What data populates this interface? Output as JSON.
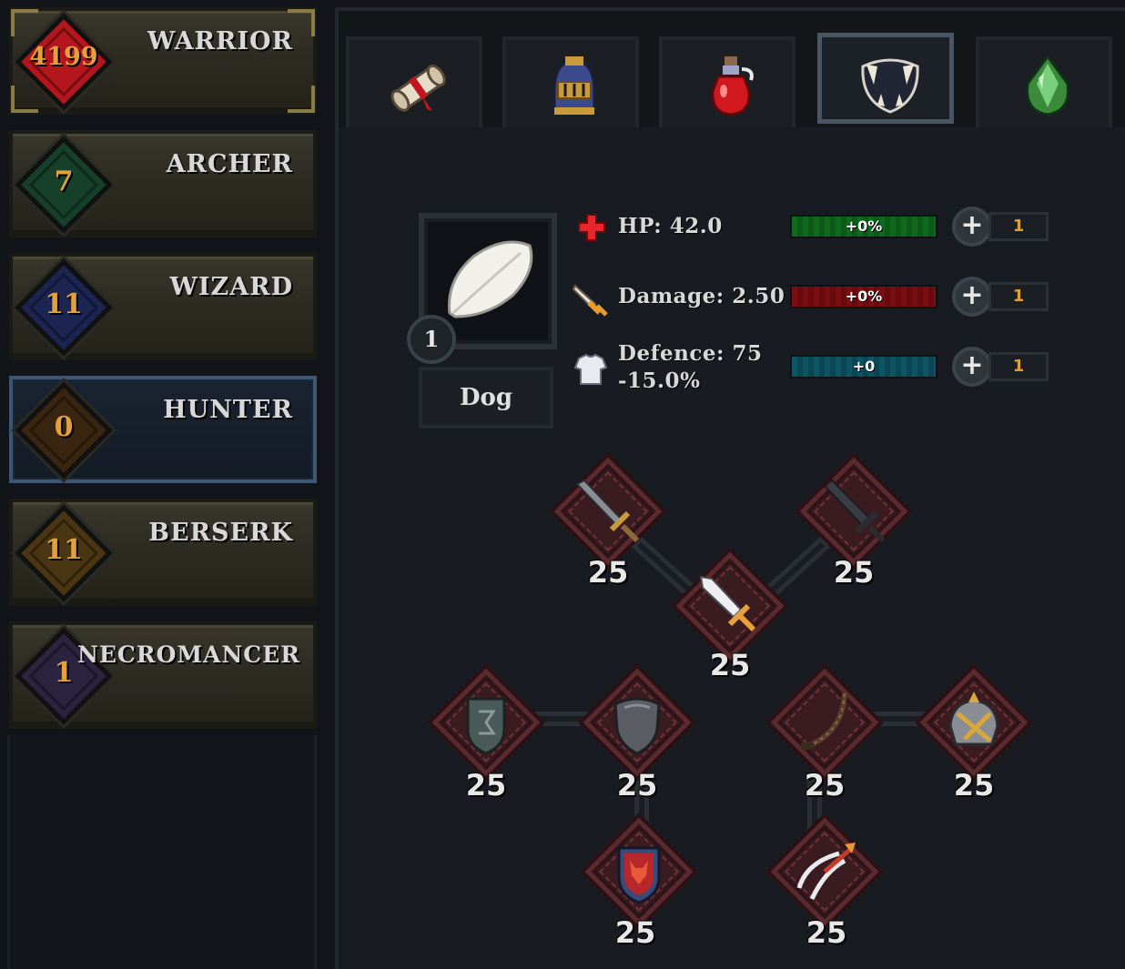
{
  "classes": [
    {
      "name": "WARRIOR",
      "level": "4199",
      "gem_color": "#b3161c",
      "state": "active"
    },
    {
      "name": "ARCHER",
      "level": "7",
      "gem_color": "#16402a",
      "state": "normal"
    },
    {
      "name": "WIZARD",
      "level": "11",
      "gem_color": "#1c2452",
      "state": "normal"
    },
    {
      "name": "HUNTER",
      "level": "0",
      "gem_color": "#3a2610",
      "state": "selected"
    },
    {
      "name": "BERSERK",
      "level": "11",
      "gem_color": "#4a3612",
      "state": "normal"
    },
    {
      "name": "NECROMANCER",
      "level": "1",
      "gem_color": "#2b2340",
      "state": "normal"
    }
  ],
  "tabs": [
    {
      "icon": "scroll-icon",
      "active": false
    },
    {
      "icon": "helmet-icon",
      "active": false
    },
    {
      "icon": "potion-icon",
      "active": false
    },
    {
      "icon": "fangs-icon",
      "active": true
    },
    {
      "icon": "green-gem-icon",
      "active": false
    }
  ],
  "pet": {
    "name": "Dog",
    "level": "1",
    "icon": "feather-icon"
  },
  "stats": {
    "hp": {
      "label": "HP: 42.0",
      "bonus": "+0%",
      "count": "1",
      "icon": "red-cross-icon"
    },
    "damage": {
      "label": "Damage: 2.50",
      "bonus": "+0%",
      "count": "1",
      "icon": "sword-icon"
    },
    "defence": {
      "label_line1": "Defence: 75",
      "label_line2": "-15.0%",
      "bonus": "+0",
      "count": "1",
      "icon": "armor-icon"
    }
  },
  "skills": [
    {
      "icon": "broadsword-icon",
      "level": "25"
    },
    {
      "icon": "dark-sword-icon",
      "level": "25"
    },
    {
      "icon": "dagger-icon",
      "level": "25"
    },
    {
      "icon": "rune-shield-icon",
      "level": "25"
    },
    {
      "icon": "iron-shield-icon",
      "level": "25"
    },
    {
      "icon": "whip-icon",
      "level": "25"
    },
    {
      "icon": "gold-helmet-icon",
      "level": "25"
    },
    {
      "icon": "fox-shield-icon",
      "level": "25"
    },
    {
      "icon": "crossbow-icon",
      "level": "25"
    }
  ]
}
